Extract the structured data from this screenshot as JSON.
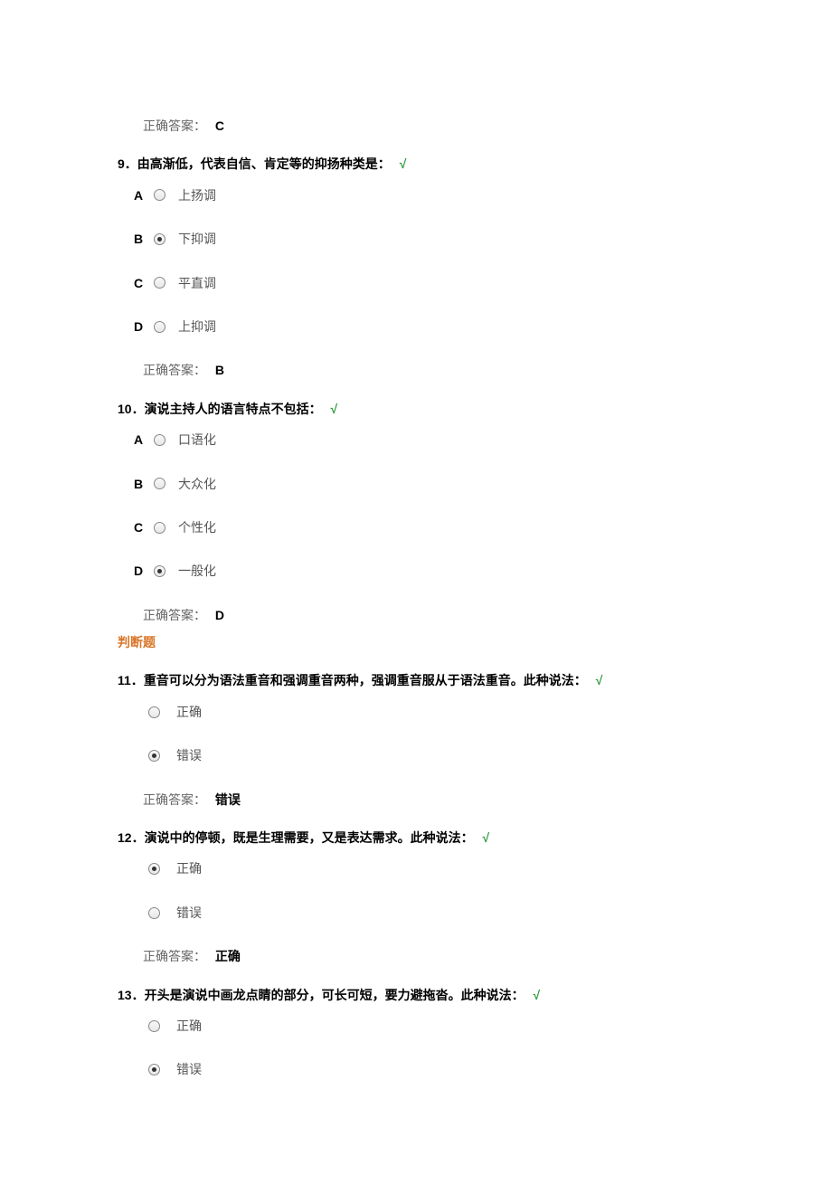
{
  "prev_answer": {
    "label": "正确答案：",
    "value": "C"
  },
  "q9": {
    "number": "9．",
    "text": "由高渐低，代表自信、肯定等的抑扬种类是：",
    "check": "√",
    "options": [
      {
        "letter": "A",
        "text": "上扬调",
        "selected": false
      },
      {
        "letter": "B",
        "text": "下抑调",
        "selected": true
      },
      {
        "letter": "C",
        "text": "平直调",
        "selected": false
      },
      {
        "letter": "D",
        "text": "上抑调",
        "selected": false
      }
    ],
    "answer_label": "正确答案：",
    "answer_value": "B"
  },
  "q10": {
    "number": "10．",
    "text": "演说主持人的语言特点不包括：",
    "check": "√",
    "options": [
      {
        "letter": "A",
        "text": "口语化",
        "selected": false
      },
      {
        "letter": "B",
        "text": "大众化",
        "selected": false
      },
      {
        "letter": "C",
        "text": "个性化",
        "selected": false
      },
      {
        "letter": "D",
        "text": "一般化",
        "selected": true
      }
    ],
    "answer_label": "正确答案：",
    "answer_value": "D"
  },
  "section_tf": "判断题",
  "q11": {
    "number": "11．",
    "text": "重音可以分为语法重音和强调重音两种，强调重音服从于语法重音。此种说法：",
    "check": "√",
    "options": [
      {
        "text": "正确",
        "selected": false
      },
      {
        "text": "错误",
        "selected": true
      }
    ],
    "answer_label": "正确答案：",
    "answer_value": "错误"
  },
  "q12": {
    "number": "12．",
    "text": "演说中的停顿，既是生理需要，又是表达需求。此种说法：",
    "check": "√",
    "options": [
      {
        "text": "正确",
        "selected": true
      },
      {
        "text": "错误",
        "selected": false
      }
    ],
    "answer_label": "正确答案：",
    "answer_value": "正确"
  },
  "q13": {
    "number": "13．",
    "text": "开头是演说中画龙点睛的部分，可长可短，要力避拖沓。此种说法：",
    "check": "√",
    "options": [
      {
        "text": "正确",
        "selected": false
      },
      {
        "text": "错误",
        "selected": true
      }
    ]
  }
}
